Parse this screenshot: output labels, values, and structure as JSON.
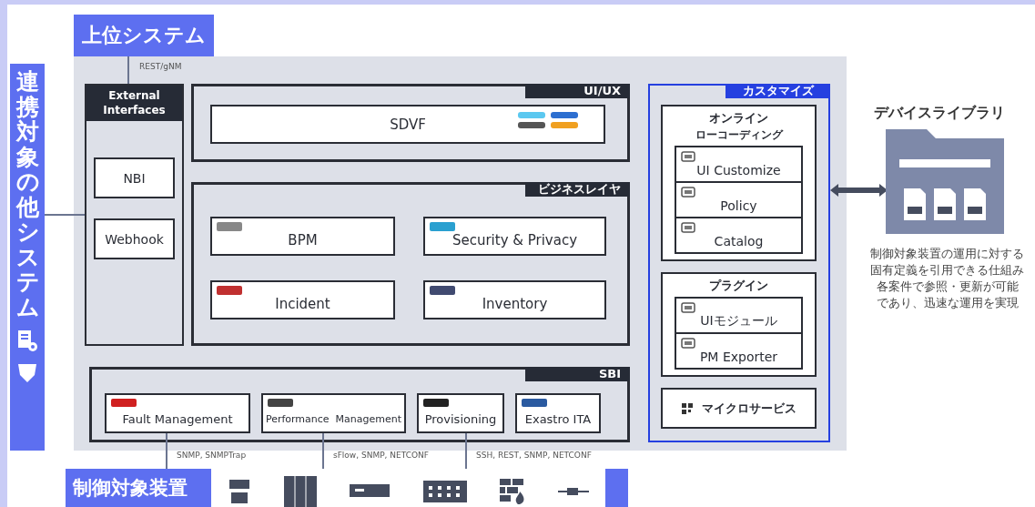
{
  "upper_system": {
    "title": "上位システム",
    "protocol": "REST/gNM"
  },
  "other_systems": {
    "title": "連携対象の他システム"
  },
  "external_interfaces": {
    "title": "External Interfaces",
    "items": [
      "NBI",
      "Webhook"
    ]
  },
  "layers": [
    {
      "title": "UI/UX",
      "components": [
        {
          "label": "SDVF"
        }
      ]
    },
    {
      "title": "ビジネスレイヤ",
      "components": [
        {
          "label": "BPM"
        },
        {
          "label": "Security & Privacy"
        },
        {
          "label": "Incident"
        },
        {
          "label": "Inventory"
        }
      ]
    }
  ],
  "sbi": {
    "title": "SBI",
    "components": [
      {
        "label": "Fault Management",
        "link": "SNMP, SNMPTrap"
      },
      {
        "label": "Performance  Management",
        "link": "sFlow, SNMP, NETCONF"
      },
      {
        "label": "Provisioning",
        "link": "SSH, REST, SNMP, NETCONF"
      },
      {
        "label": "Exastro ITA"
      }
    ]
  },
  "customize": {
    "title": "カスタマイズ",
    "groups": [
      {
        "title": "オンライン",
        "subtitle": "ローコーディング",
        "items": [
          "UI Customize",
          "Policy",
          "Catalog"
        ]
      },
      {
        "title": "プラグイン",
        "items": [
          "UIモジュール",
          "PM Exporter"
        ]
      },
      {
        "title": "マイクロサービス"
      }
    ]
  },
  "device_library": {
    "title": "デバイスライブラリ",
    "description": [
      "制御対象装置の運用に対する",
      "固有定義を引用できる仕組み",
      "各案件で参照・更新が可能",
      "であり、迅速な運用を実現"
    ]
  },
  "controlled_devices": {
    "title": "制御対象装置"
  }
}
